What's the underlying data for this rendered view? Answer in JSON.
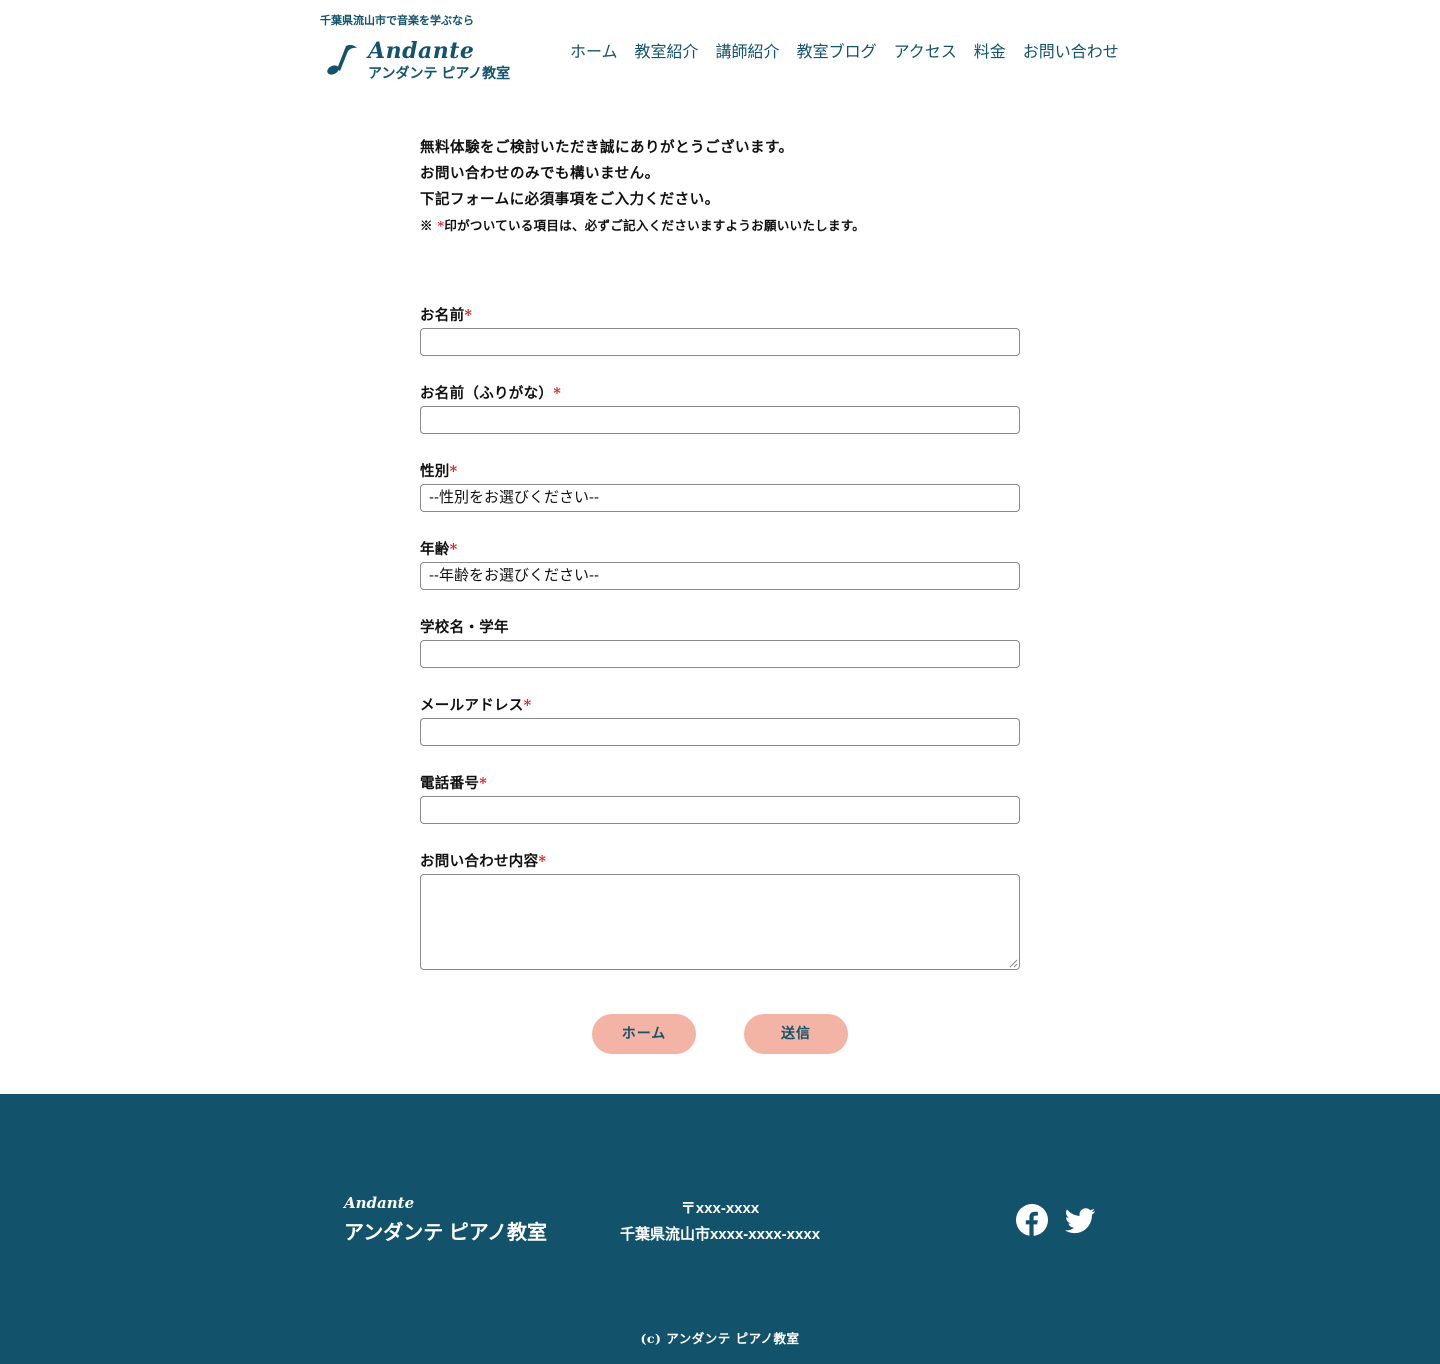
{
  "header": {
    "tagline": "千葉県流山市で音楽を学ぶなら",
    "brand": "Andante",
    "brand_jp": "アンダンテ ピアノ教室"
  },
  "nav": {
    "items": [
      "ホーム",
      "教室紹介",
      "講師紹介",
      "教室ブログ",
      "アクセス",
      "料金",
      "お問い合わせ"
    ]
  },
  "intro": {
    "line1": "無料体験をご検討いただき誠にありがとうございます。",
    "line2": "お問い合わせのみでも構いません。",
    "line3": "下記フォームに必須事項をご入力ください。",
    "note_prefix": "※",
    "note_mark": "*",
    "note_text": "印がついている項目は、必ずご記入くださいますようお願いいたします。"
  },
  "form": {
    "required_mark": "*",
    "name_label": "お名前",
    "kana_label": "お名前（ふりがな）",
    "gender_label": "性別",
    "gender_value": "--性別をお選びください--",
    "age_label": "年齢",
    "age_value": "--年齢をお選びください--",
    "school_label": "学校名・学年",
    "email_label": "メールアドレス",
    "phone_label": "電話番号",
    "message_label": "お問い合わせ内容"
  },
  "buttons": {
    "home": "ホーム",
    "send": "送信",
    "color": "#f3b3a5"
  },
  "footer": {
    "brand": "Andante",
    "brand_jp": "アンダンテ ピアノ教室",
    "postal": "〒xxx-xxxx",
    "address": "千葉県流山市xxxx-xxxx-xxxx",
    "social_icons": [
      "facebook-icon",
      "twitter-icon"
    ],
    "copyright": "(c) アンダンテ ピアノ教室",
    "background": "#12536b"
  },
  "colors": {
    "accent": "#13536b",
    "required": "#e02020"
  }
}
